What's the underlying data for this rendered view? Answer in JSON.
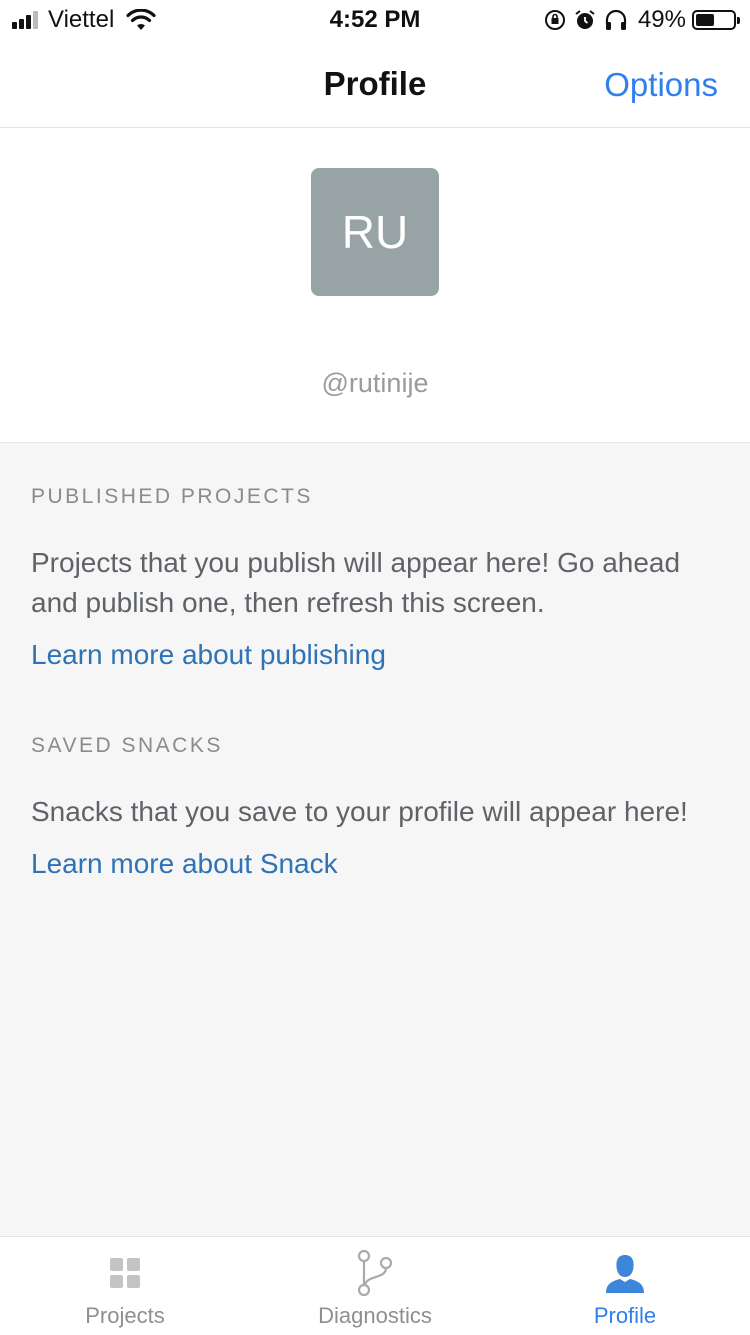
{
  "status_bar": {
    "carrier": "Viettel",
    "time": "4:52 PM",
    "battery_percent": "49%",
    "battery_level": 0.49
  },
  "nav": {
    "title": "Profile",
    "options_label": "Options",
    "accent_color": "#2f80ed"
  },
  "profile": {
    "avatar_initials": "RU",
    "avatar_color": "#97a3a4",
    "username": "@rutinije"
  },
  "sections": [
    {
      "heading": "PUBLISHED PROJECTS",
      "body": "Projects that you publish will appear here! Go ahead and publish one, then refresh this screen.",
      "link": "Learn more about publishing"
    },
    {
      "heading": "SAVED SNACKS",
      "body": "Snacks that you save to your profile will appear here!",
      "link": "Learn more about Snack"
    }
  ],
  "tabs": [
    {
      "label": "Projects",
      "icon": "grid-icon",
      "active": false
    },
    {
      "label": "Diagnostics",
      "icon": "branch-icon",
      "active": false
    },
    {
      "label": "Profile",
      "icon": "person-icon",
      "active": true
    }
  ]
}
